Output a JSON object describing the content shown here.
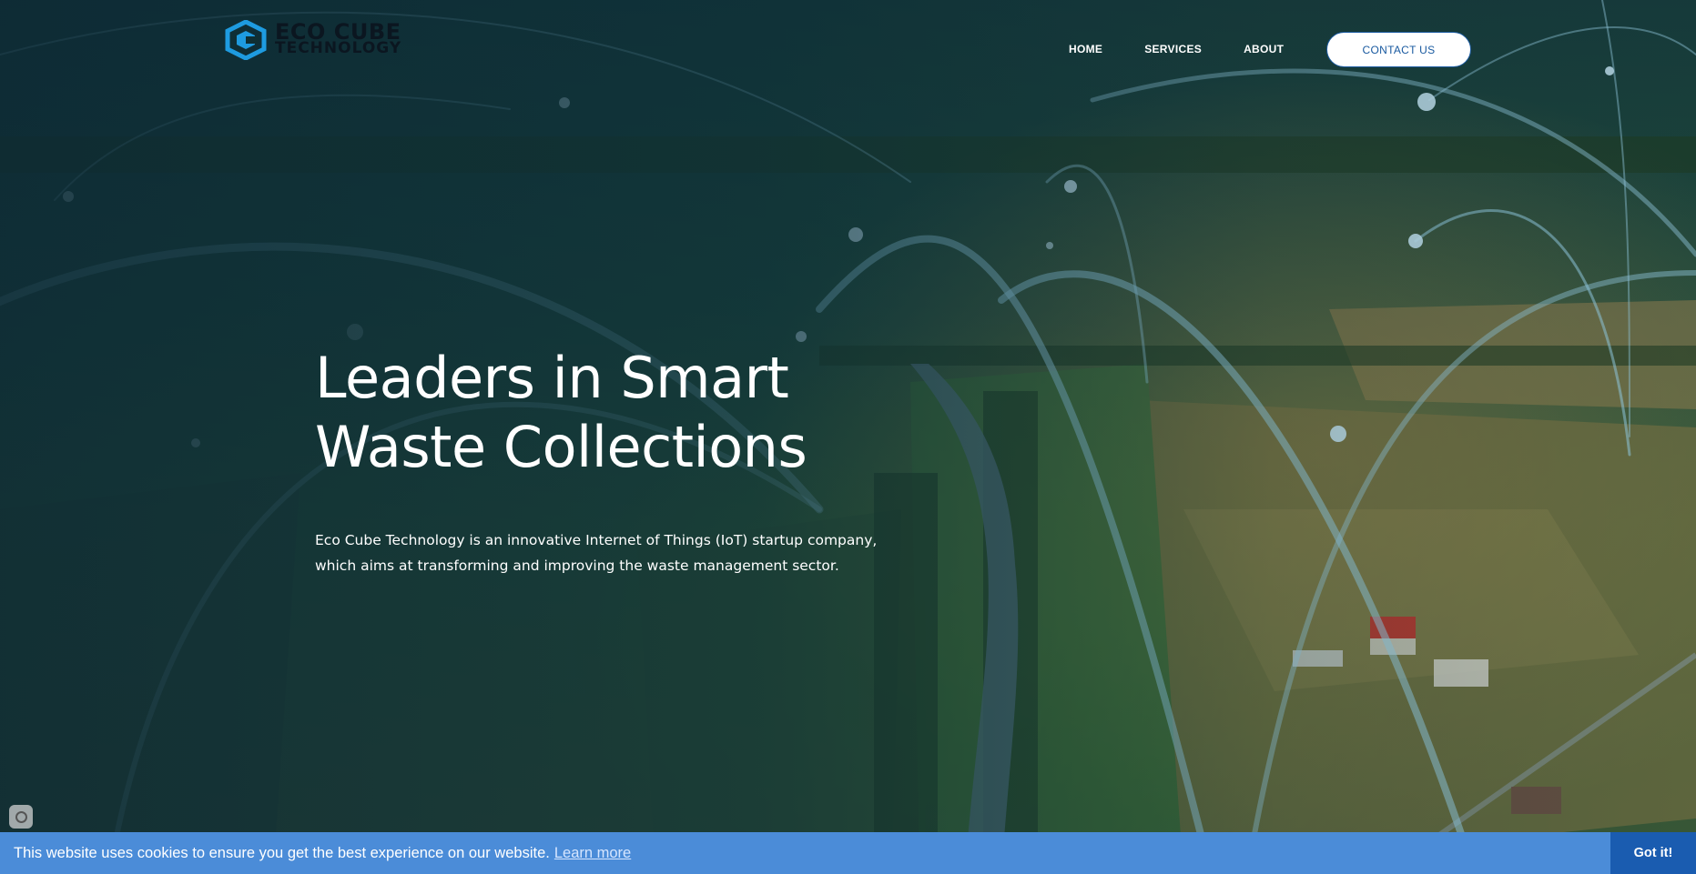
{
  "brand": {
    "line1": "ECO CUBE",
    "line2": "TECHNOLOGY",
    "logo_color": "#1e9be0"
  },
  "nav": {
    "items": [
      {
        "label": "HOME"
      },
      {
        "label": "SERVICES"
      },
      {
        "label": "ABOUT"
      }
    ],
    "contact_label": "CONTACT US"
  },
  "hero": {
    "headline_line1": "Leaders in Smart",
    "headline_line2": "Waste Collections",
    "description": "Eco Cube Technology is an innovative Internet of Things (IoT) startup company, which aims at transforming and improving the waste management sector."
  },
  "cookie": {
    "message": "This website uses cookies to ensure you get the best experience on our website.",
    "link_label": "Learn more",
    "accept_label": "Got it!"
  },
  "colors": {
    "accent": "#1a5aa0",
    "cookie_bar": "#4b8cd8",
    "cookie_button": "#1a5cb0"
  }
}
